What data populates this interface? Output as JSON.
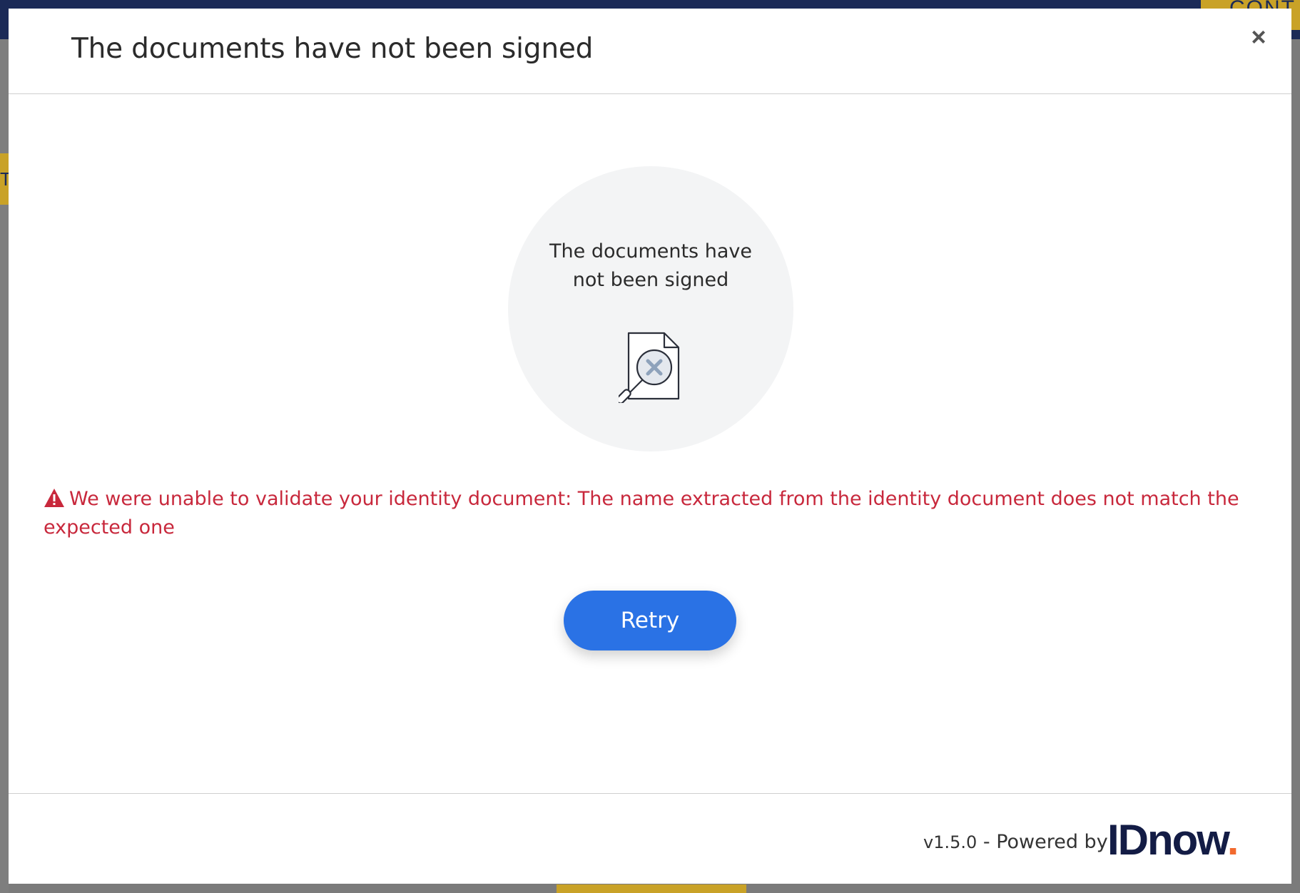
{
  "background": {
    "top_button_label": "CONT",
    "left_tab_label": "T"
  },
  "modal": {
    "title": "The documents have not been signed",
    "close_label": "×",
    "status": {
      "line1": "The documents have",
      "line2": "not been signed",
      "icon": "document-search-error-icon"
    },
    "error": {
      "icon": "warning-triangle-icon",
      "message": "We were unable to validate your identity document: The name extracted from the identity document does not match the expected one"
    },
    "retry_label": "Retry",
    "footer": {
      "version": "v1.5.0",
      "powered_by": " - Powered by",
      "brand": "IDnow",
      "brand_dot": "."
    }
  },
  "colors": {
    "primary_button": "#2a72e5",
    "error_text": "#c8283c",
    "brand_navy": "#131c45",
    "brand_orange": "#f26a2e",
    "circle_bg": "#f3f4f5"
  }
}
